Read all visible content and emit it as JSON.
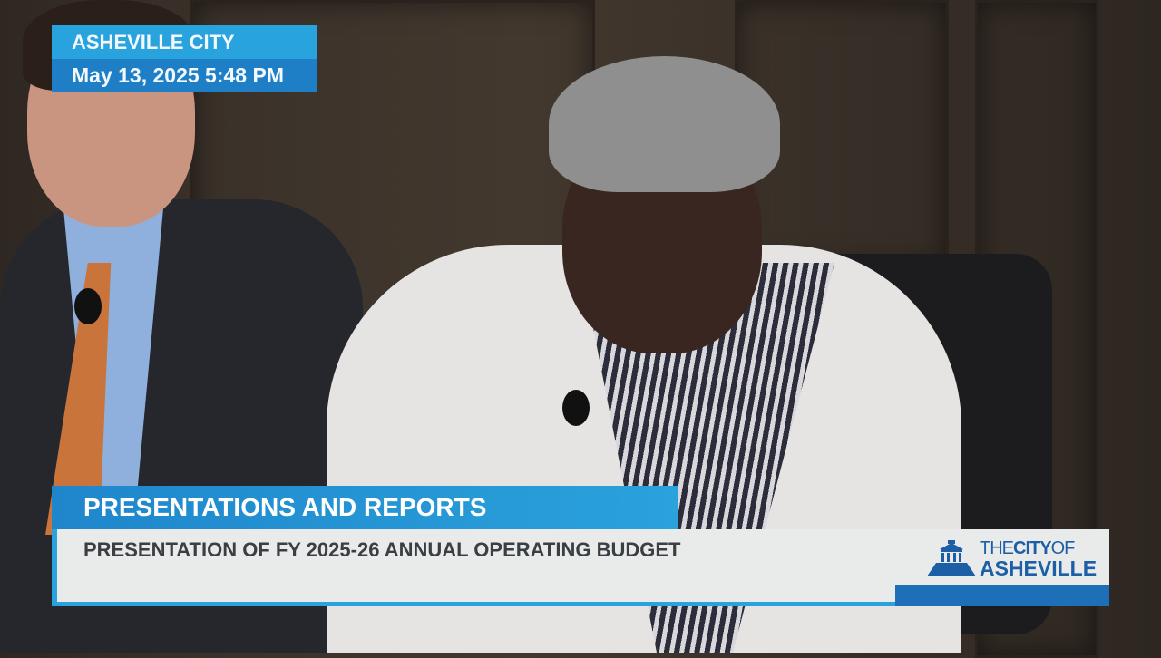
{
  "bug": {
    "title": "ASHEVILLE CITY COUNCIL",
    "datetime": "May 13, 2025  5:48 PM"
  },
  "lower_third": {
    "section": "PRESENTATIONS AND REPORTS",
    "item": "PRESENTATION OF FY 2025-26 ANNUAL OPERATING BUDGET"
  },
  "logo": {
    "the": "THE",
    "city": "CITY",
    "of": "OF",
    "name": "ASHEVILLE"
  },
  "colors": {
    "light_blue": "#29a3dd",
    "dark_blue": "#1e7fc6",
    "logo_blue": "#1d5fa6"
  }
}
